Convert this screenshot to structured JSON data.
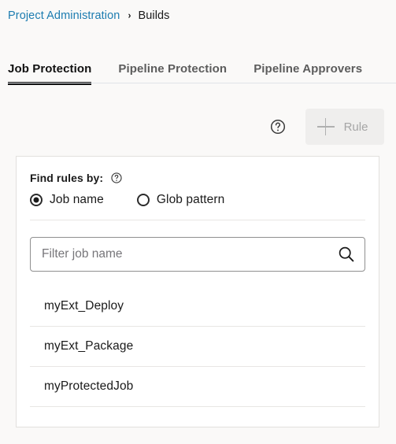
{
  "breadcrumb": {
    "link_label": "Project Administration",
    "separator": "›",
    "current_label": "Builds"
  },
  "tabs": [
    {
      "label": "Job Protection",
      "active": true
    },
    {
      "label": "Pipeline Protection",
      "active": false
    },
    {
      "label": "Pipeline Approvers",
      "active": false
    }
  ],
  "toolbar": {
    "help_icon": "help-circle-icon",
    "add_rule_label": "Rule",
    "add_rule_icon": "plus-icon",
    "add_rule_disabled": true
  },
  "card": {
    "find_rules_label": "Find rules by:",
    "find_rules_help_icon": "help-circle-icon",
    "radio_options": [
      {
        "label": "Job name",
        "selected": true
      },
      {
        "label": "Glob pattern",
        "selected": false
      }
    ],
    "search": {
      "placeholder": "Filter job name",
      "value": "",
      "icon": "search-icon"
    },
    "job_items": [
      {
        "label": "myExt_Deploy"
      },
      {
        "label": "myExt_Package"
      },
      {
        "label": "myProtectedJob"
      }
    ]
  },
  "colors": {
    "page_background": "#faf9f8",
    "link": "#1c7cb0",
    "text": "#1a1a1a",
    "tab_inactive": "#5c5c5c",
    "tab_active_underline": "#111111",
    "card_border": "#e2e0de",
    "divider": "#e8e6e4",
    "disabled_button_bg": "#efeeed",
    "disabled_button_text": "#a6a6a6",
    "placeholder": "#77767a"
  }
}
